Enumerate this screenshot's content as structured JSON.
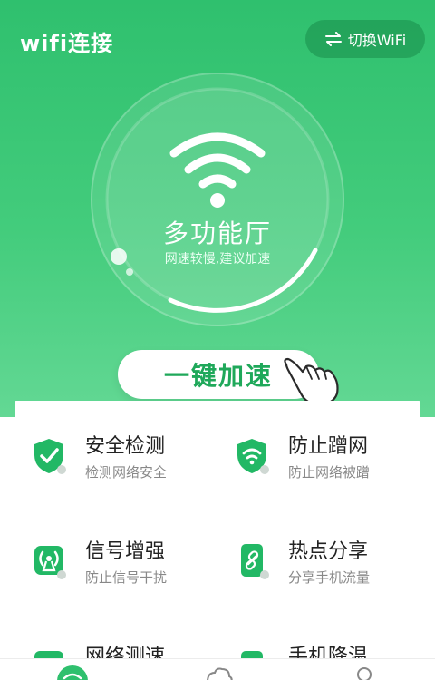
{
  "header": {
    "title": "wifi连接",
    "switch_label": "切换WiFi"
  },
  "hero": {
    "hall_name": "多功能厅",
    "hall_status": "网速较慢,建议加速"
  },
  "accelerate_label": "一键加速",
  "features": [
    {
      "title": "安全检测",
      "desc": "检测网络安全",
      "icon": "shield-check-icon"
    },
    {
      "title": "防止蹭网",
      "desc": "防止网络被蹭",
      "icon": "shield-wifi-icon"
    },
    {
      "title": "信号增强",
      "desc": "防止信号干扰",
      "icon": "signal-icon"
    },
    {
      "title": "热点分享",
      "desc": "分享手机流量",
      "icon": "link-icon"
    },
    {
      "title": "网络测速",
      "desc": "",
      "icon": "speed-icon"
    },
    {
      "title": "手机降温",
      "desc": "",
      "icon": "cool-icon"
    }
  ],
  "tabbar": {
    "items": [
      "wifi-tab-icon",
      "clean-tab-icon",
      "profile-tab-icon"
    ]
  },
  "colors": {
    "accent": "#2fc06e",
    "accent_dark": "#1fa85a",
    "text_dark": "#222222",
    "text_muted": "#888888"
  }
}
